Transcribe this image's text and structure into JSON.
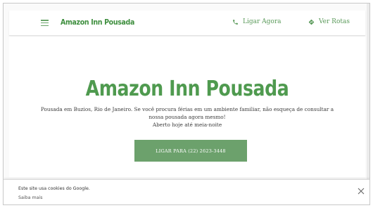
{
  "header": {
    "menu_icon": "menu-icon",
    "brand": "Amazon Inn Pousada",
    "call_label": "Ligar Agora",
    "call_icon": "phone-icon",
    "route_label": "Ver Rotas",
    "route_icon": "directions-icon"
  },
  "hero": {
    "title": "Amazon Inn Pousada",
    "description": "Pousada em Buzios, Rio de Janeiro. Se você procura férias em um ambiente familiar, não esqueça de consultar a nossa pousada agora mesmo!",
    "hours": "Aberto hoje até meia-noite",
    "cta_label": "LIGAR PARA (22) 2623-3448"
  },
  "cookie_banner": {
    "text": "Este site usa cookies do Google.",
    "link": "Saiba mais",
    "close_icon": "close-icon"
  },
  "colors": {
    "accent": "#4f9a4f",
    "button": "#6ca16c",
    "brand": "#3f8f3f"
  }
}
